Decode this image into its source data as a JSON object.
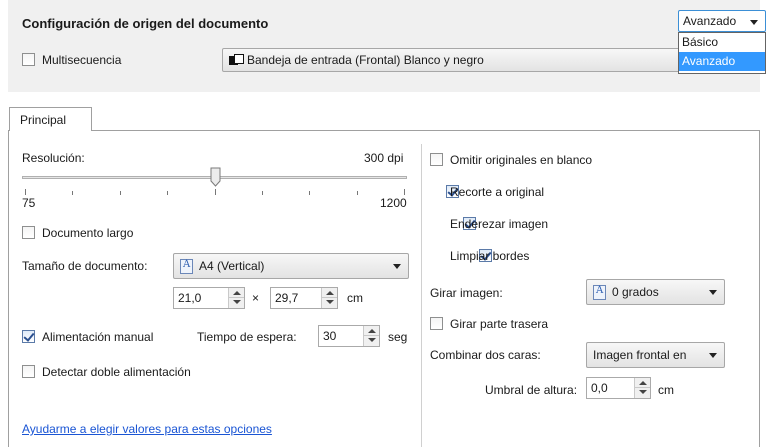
{
  "header": {
    "title": "Configuración de origen del documento",
    "mode_selected": "Avanzado",
    "mode_options": [
      "Básico",
      "Avanzado"
    ],
    "multisequence_label": "Multisecuencia",
    "multisequence_checked": false,
    "source_value": "Bandeja de entrada (Frontal) Blanco y negro"
  },
  "tabs": [
    {
      "label": "Principal",
      "active": true
    }
  ],
  "left": {
    "resolution_label": "Resolución:",
    "resolution_value": "300 dpi",
    "slider_min": "75",
    "slider_max": "1200",
    "slider_level_fraction": 0.5,
    "long_doc_label": "Documento largo",
    "long_doc_checked": false,
    "doc_size_label": "Tamaño de documento:",
    "doc_size_value": "A4 (Vertical)",
    "width_value": "21,0",
    "times_symbol": "×",
    "height_value": "29,7",
    "unit": "cm",
    "manual_feed_label": "Alimentación manual",
    "manual_feed_checked": true,
    "timeout_label": "Tiempo de espera:",
    "timeout_value": "30",
    "timeout_unit": "seg",
    "double_feed_label": "Detectar doble alimentación",
    "double_feed_checked": false
  },
  "right": {
    "skip_blank_label": "Omitir originales en blanco",
    "skip_blank_checked": false,
    "crop_label": "Recorte a original",
    "crop_checked": true,
    "straighten_label": "Enderezar imagen",
    "straighten_checked": true,
    "clean_edges_label": "Limpiar bordes",
    "clean_edges_checked": true,
    "rotate_label": "Girar imagen:",
    "rotate_value": "0 grados",
    "rotate_back_label": "Girar parte trasera",
    "rotate_back_checked": false,
    "combine_label": "Combinar dos caras:",
    "combine_value": "Imagen frontal en",
    "height_threshold_label": "Umbral de altura:",
    "height_threshold_value": "0,0",
    "height_threshold_unit": "cm"
  },
  "help_link": "Ayudarme a elegir valores para estas opciones"
}
